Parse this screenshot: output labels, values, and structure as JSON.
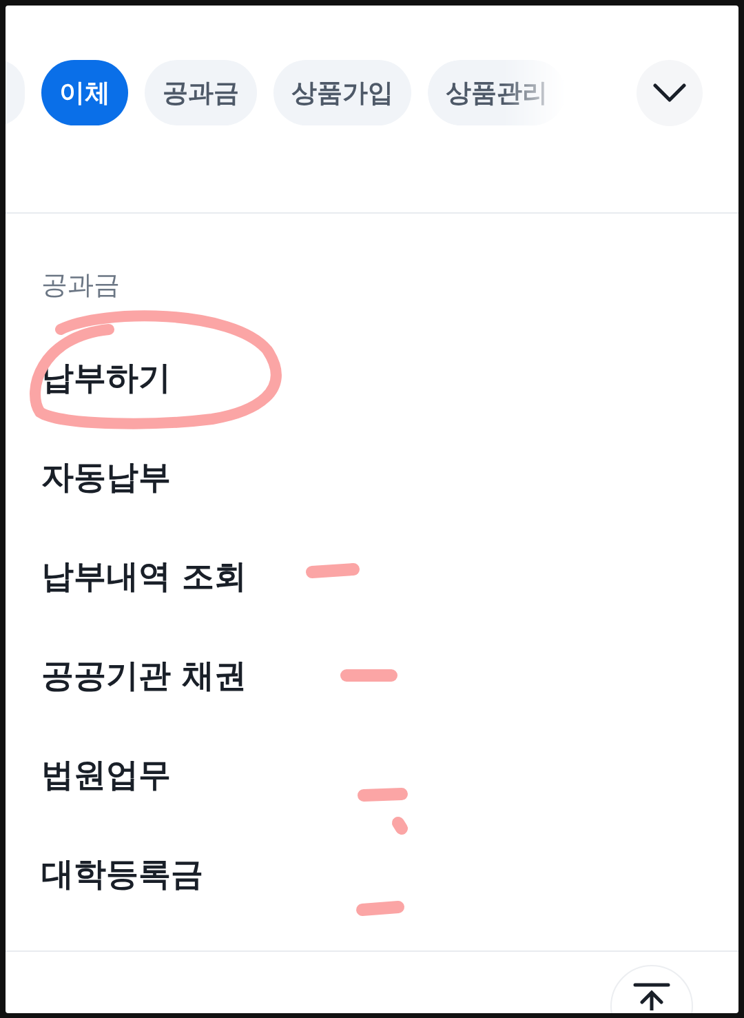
{
  "tabs": [
    {
      "selected": false
    },
    {
      "label": "이체",
      "selected": true
    },
    {
      "label": "공과금",
      "selected": false
    },
    {
      "label": "상품가입",
      "selected": false
    },
    {
      "label": "상품관리",
      "selected": false
    }
  ],
  "section": {
    "title": "공과금",
    "items": [
      "납부하기",
      "자동납부",
      "납부내역 조회",
      "공공기관 채권",
      "법원업무",
      "대학등록금"
    ]
  }
}
